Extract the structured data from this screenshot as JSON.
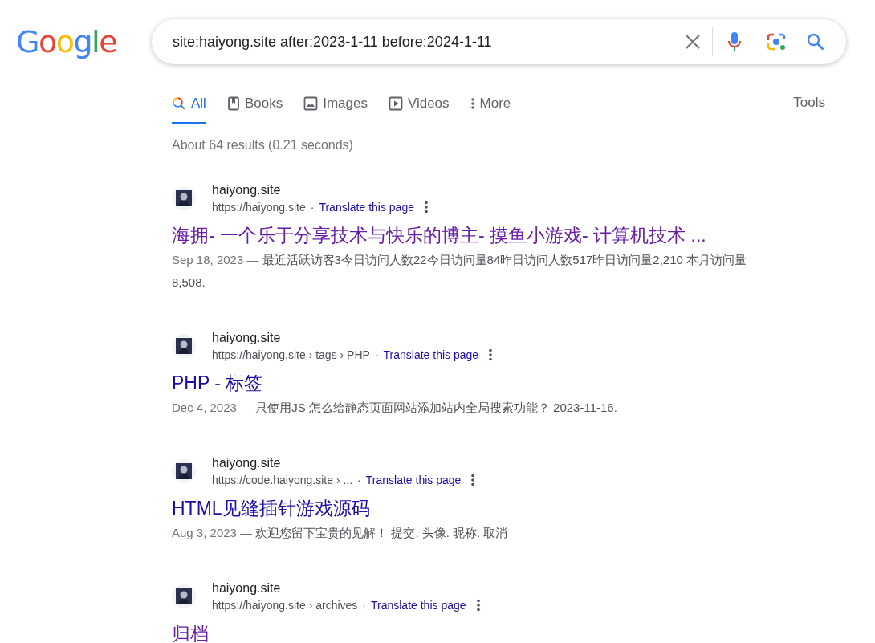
{
  "logo": "Google",
  "search": {
    "value": "site:haiyong.site after:2023-1-11 before:2024-1-11"
  },
  "tabs": [
    {
      "label": "All",
      "kind": "search",
      "selected": true
    },
    {
      "label": "Books",
      "kind": "book",
      "selected": false
    },
    {
      "label": "Images",
      "kind": "image",
      "selected": false
    },
    {
      "label": "Videos",
      "kind": "video",
      "selected": false
    },
    {
      "label": "More",
      "kind": "more",
      "selected": false
    }
  ],
  "tools": "Tools",
  "stats": "About 64 results (0.21 seconds)",
  "results": [
    {
      "site": "haiyong.site",
      "url": "https://haiyong.site",
      "separator": "·",
      "translate": "Translate this page",
      "title": "海拥- 一个乐于分享技术与快乐的博主- 摸鱼小游戏- 计算机技术 ...",
      "visited": true,
      "date": "Sep 18, 2023 —",
      "snippet": "最近活跃访客3今日访问人数22今日访问量84昨日访问人数517昨日访问量2,210 本月访问量8,508."
    },
    {
      "site": "haiyong.site",
      "url": "https://haiyong.site › tags › PHP",
      "separator": "·",
      "translate": "Translate this page",
      "title": "PHP - 标签",
      "visited": false,
      "date": "Dec 4, 2023 —",
      "snippet": "只使用JS 怎么给静态页面网站添加站内全局搜索功能？ 2023-11-16."
    },
    {
      "site": "haiyong.site",
      "url": "https://code.haiyong.site › ...",
      "separator": "·",
      "translate": "Translate this page",
      "title": "HTML见缝插针游戏源码",
      "visited": false,
      "date": "Aug 3, 2023 —",
      "snippet": "欢迎您留下宝贵的见解！ 提交. 头像. 昵称. 取消"
    },
    {
      "site": "haiyong.site",
      "url": "https://haiyong.site › archives",
      "separator": "·",
      "translate": "Translate this page",
      "title": "归档",
      "visited": true
    }
  ]
}
